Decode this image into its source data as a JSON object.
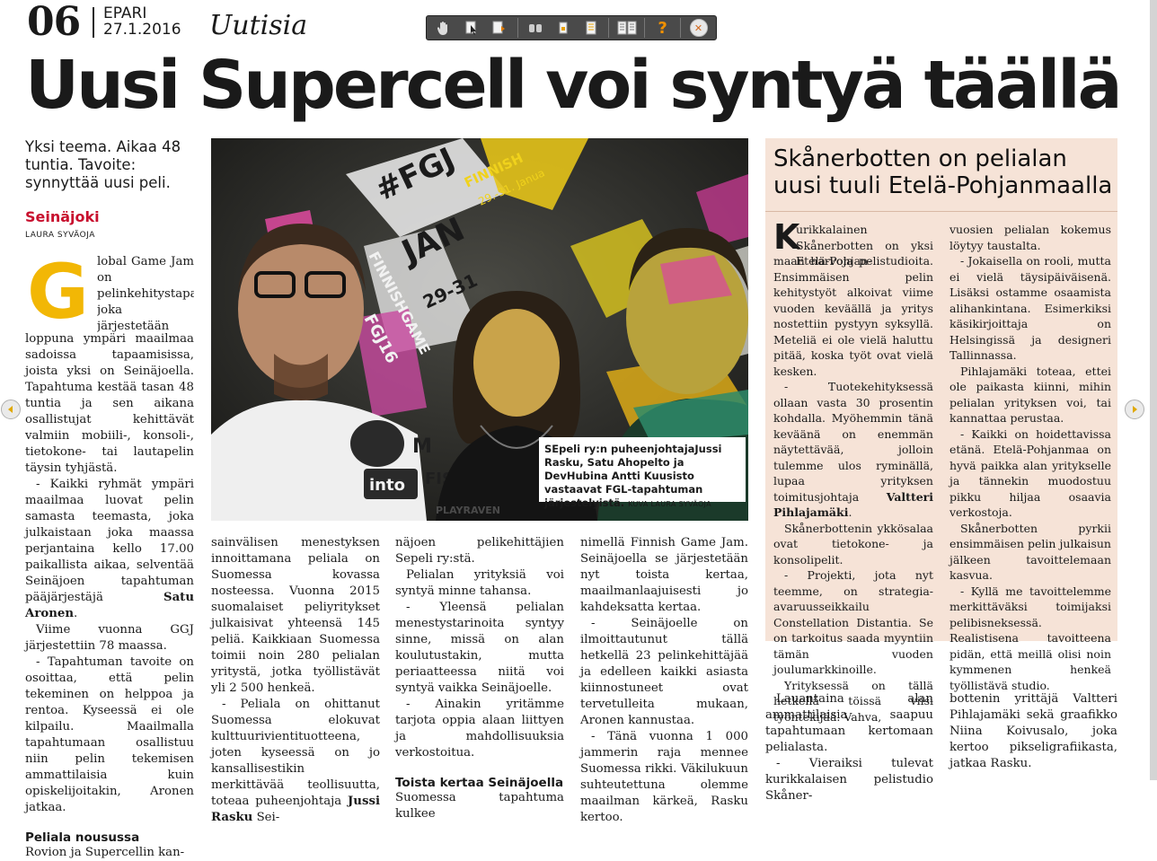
{
  "header": {
    "page_number": "06",
    "paper": "EPARI",
    "date": "27.1.2016",
    "section": "Uutisia"
  },
  "toolbar": {
    "icons": [
      "hand-tool-icon",
      "pointer-icon",
      "page-turn-icon",
      "zoom-icon",
      "single-page-icon",
      "page-view-icon",
      "double-page-icon",
      "help-icon",
      "close-icon"
    ],
    "help_glyph": "?",
    "close_glyph": "✕"
  },
  "headline": "Uusi Supercell voi syntyä täällä",
  "lead": "Yksi teema. Aikaa 48 tuntia. Tavoite: synnyttää uusi peli.",
  "dateline": "Seinäjoki",
  "byline": "LAURA SYVÄOJA",
  "dropcap": "G",
  "col1": {
    "p1_first": "lobal Game Jam on pelinkehitystapahtuma, joka järjestetään tulevana viikonloppuna ympäri maailmaa sadoissa tapaamisissa, joista yksi on Seinäjoella. Tapahtuma kestää tasan 48 tuntia ja sen aikana osallistujat kehittävät valmiin mobiili-, konsoli-, tietokone- tai lautapelin täysin tyhjästä.",
    "p2": "- Kaikki ryhmät ympäri maailmaa luovat pelin samasta teemasta, joka julkaistaan joka maassa perjantaina kello 17.00 paikallista aikaa, selventää Seinäjoen tapahtuman pääjärjestäjä",
    "p2_name": "Satu Aronen",
    "p3": "Viime vuonna GGJ järjestettiin 78 maassa.",
    "p4": "- Tapahtuman tavoite on osoittaa, että pelin tekeminen on helppoa ja rentoa. Kyseessä ei ole kilpailu. Maailmalla tapahtumaan osallistuu niin pelin tekemisen ammattilaisia kuin opiskelijoitakin, Aronen jatkaa.",
    "subhead": "Peliala nousussa",
    "p5": "Rovion ja Supercellin kan-"
  },
  "col2": {
    "p1": "sainvälisen menestyksen innoittamana peliala on Suomessa kovassa nosteessa. Vuonna 2015 suomalaiset peliyritykset julkaisivat yhteensä 145 peliä. Kaikkiaan Suomessa toimii noin 280 pelialan yritystä, jotka työllistävät yli 2 500 henkeä.",
    "p2": "- Peliala on ohittanut Suomessa elokuvat kulttuurivientituotteena, joten kyseessä on jo kansallisestikin merkittävää teollisuutta, toteaa puheenjohtaja",
    "p2_name": "Jussi Rasku",
    "p2_end": "Sei-"
  },
  "col3": {
    "p1": "näjoen pelikehittäjien Sepeli ry:stä.",
    "p2": "Pelialan yrityksiä voi syntyä minne tahansa.",
    "p3": "- Yleensä pelialan menestystarinoita syntyy sinne, missä on alan koulutustakin, mutta periaatteessa niitä voi syntyä vaikka Seinäjoelle.",
    "p4": "- Ainakin yritämme tarjota oppia alaan liittyen ja mahdollisuuksia verkostoitua.",
    "subhead": "Toista kertaa Seinäjoella",
    "p5": "Suomessa tapahtuma kulkee"
  },
  "col4": {
    "p1": "nimellä Finnish Game Jam. Seinäjoella se järjestetään nyt toista kertaa, maailmanlaajuisesti jo kahdeksatta kertaa.",
    "p2": "- Seinäjoelle on ilmoittautunut tällä hetkellä 23 pelinkehittäjää ja edelleen kaikki asiasta kiinnostuneet ovat tervetulleita mukaan, Aronen kannustaa.",
    "p3": "- Tänä vuonna 1 000 jammerin raja mennee Suomessa rikki. Väkilukuun suhteutettuna olemme maailman kärkeä, Rasku kertoo."
  },
  "photo": {
    "caption": "SEpeli ry:n puheenjohtajaJussi Rasku, Satu Ahopelto ja DevHubina Antti Kuusisto vastaavat FGL-tapahtuman järjestelyistä.",
    "credit": "KUVA LAURA SYVÄOJA",
    "projected": [
      "#FGJ",
      "JAN",
      "29-31",
      "FINNISHGAME",
      "FGJ16",
      "FINNISH",
      "29.-31. Janua"
    ],
    "shirt_logo": "into",
    "shirt_text": "M",
    "shirt_text2": "FISH",
    "corner_text": "PLAYRAVEN"
  },
  "sidebar": {
    "title": "Skånerbotten on pelialan uusi tuuli Etelä-Pohjanmaalla",
    "dropcap": "K",
    "c1_p1": "urikkalainen Skånerbotten on yksi Etelä-Pohjanmaan harvoja pelistudioita. Ensimmäisen pelin kehitystyöt alkoivat viime vuoden keväällä ja yritys nostettiin pystyyn syksyllä. Meteliä ei ole vielä haluttu pitää, koska työt ovat vielä kesken.",
    "c1_p2": "- Tuotekehityksessä ollaan vasta 30 prosentin kohdalla. Myöhemmin tänä keväänä on enemmän näytettävää, jolloin tulemme ulos ryminällä, lupaa yrityksen toimitusjohtaja",
    "c1_p2_name": "Valtteri Pihlajamäki",
    "c1_p3": "Skånerbottenin ykkösalaa ovat tietokone- ja konsolipelit.",
    "c1_p4": "- Projekti, jota nyt teemme, on strategia-avaruusseikkailu Constellation Distantia. Se on tarkoitus saada myyntiin tämän vuoden joulumarkkinoille.",
    "c1_p5": "Yrityksessä on tällä hetkellä töissä viisi työntekijää. Vahva,",
    "c2_p1": "vuosien pelialan kokemus löytyy taustalta.",
    "c2_p2": "- Jokaisella on rooli, mutta ei vielä täysipäiväisenä. Lisäksi ostamme osaamista alihankintana. Esimerkiksi käsikirjoittaja on Helsingissä ja designeri Tallinnassa.",
    "c2_p3": "Pihlajamäki toteaa, ettei ole paikasta kiinni, mihin pelialan yrityksen voi, tai kannattaa perustaa.",
    "c2_p4": "- Kaikki on hoidettavissa etänä. Etelä-Pohjanmaa on hyvä paikka alan yritykselle ja tännekin muodostuu pikku hiljaa osaavia verkostoja.",
    "c2_p5": "Skånerbotten pyrkii ensimmäisen pelin julkaisun jälkeen tavoittelemaan kasvua.",
    "c2_p6": "- Kyllä me tavoittelemme merkittäväksi toimijaksi pelibisneksessä. Realistisena tavoitteena pidän, että meillä olisi noin kymmenen henkeä työllistävä studio."
  },
  "below_sidebar": {
    "c1": "Lauantaina alan ammattilaisia saapuu tapahtumaan kertomaan pelialasta.",
    "c1_p2": "- Vieraiksi tulevat kurikkalaisen pelistudio Skåner-",
    "c2": "bottenin yrittäjä Valtteri Pihlajamäki sekä graafikko Niina Koivusalo, joka kertoo pikseligrafiikasta, jatkaa Rasku."
  },
  "colors": {
    "accent_red": "#c8102e",
    "dropcap_yellow": "#f2b705",
    "sidebar_bg": "#f6e3d7"
  }
}
